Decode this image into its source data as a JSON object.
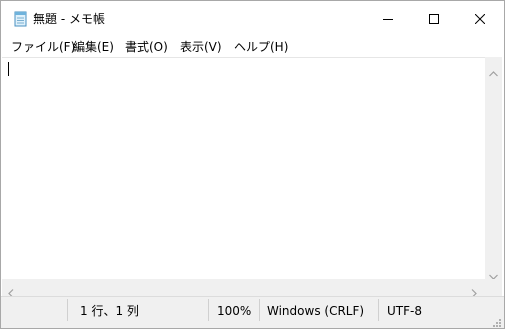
{
  "window": {
    "title": "無題 - メモ帳"
  },
  "menu": [
    {
      "label": "ファイル(F)"
    },
    {
      "label": "編集(E)"
    },
    {
      "label": "書式(O)"
    },
    {
      "label": "表示(V)"
    },
    {
      "label": "ヘルプ(H)"
    }
  ],
  "editor": {
    "content": ""
  },
  "status": {
    "position": "1 行、1 列",
    "zoom": "100%",
    "line_ending": "Windows (CRLF)",
    "encoding": "UTF-8"
  },
  "icons": {
    "app": "notepad-icon",
    "minimize": "minimize-icon",
    "maximize": "maximize-icon",
    "close": "close-icon"
  },
  "colors": {
    "scrollbar": "#f0f0f0",
    "statusbar": "#f0f0f0"
  }
}
